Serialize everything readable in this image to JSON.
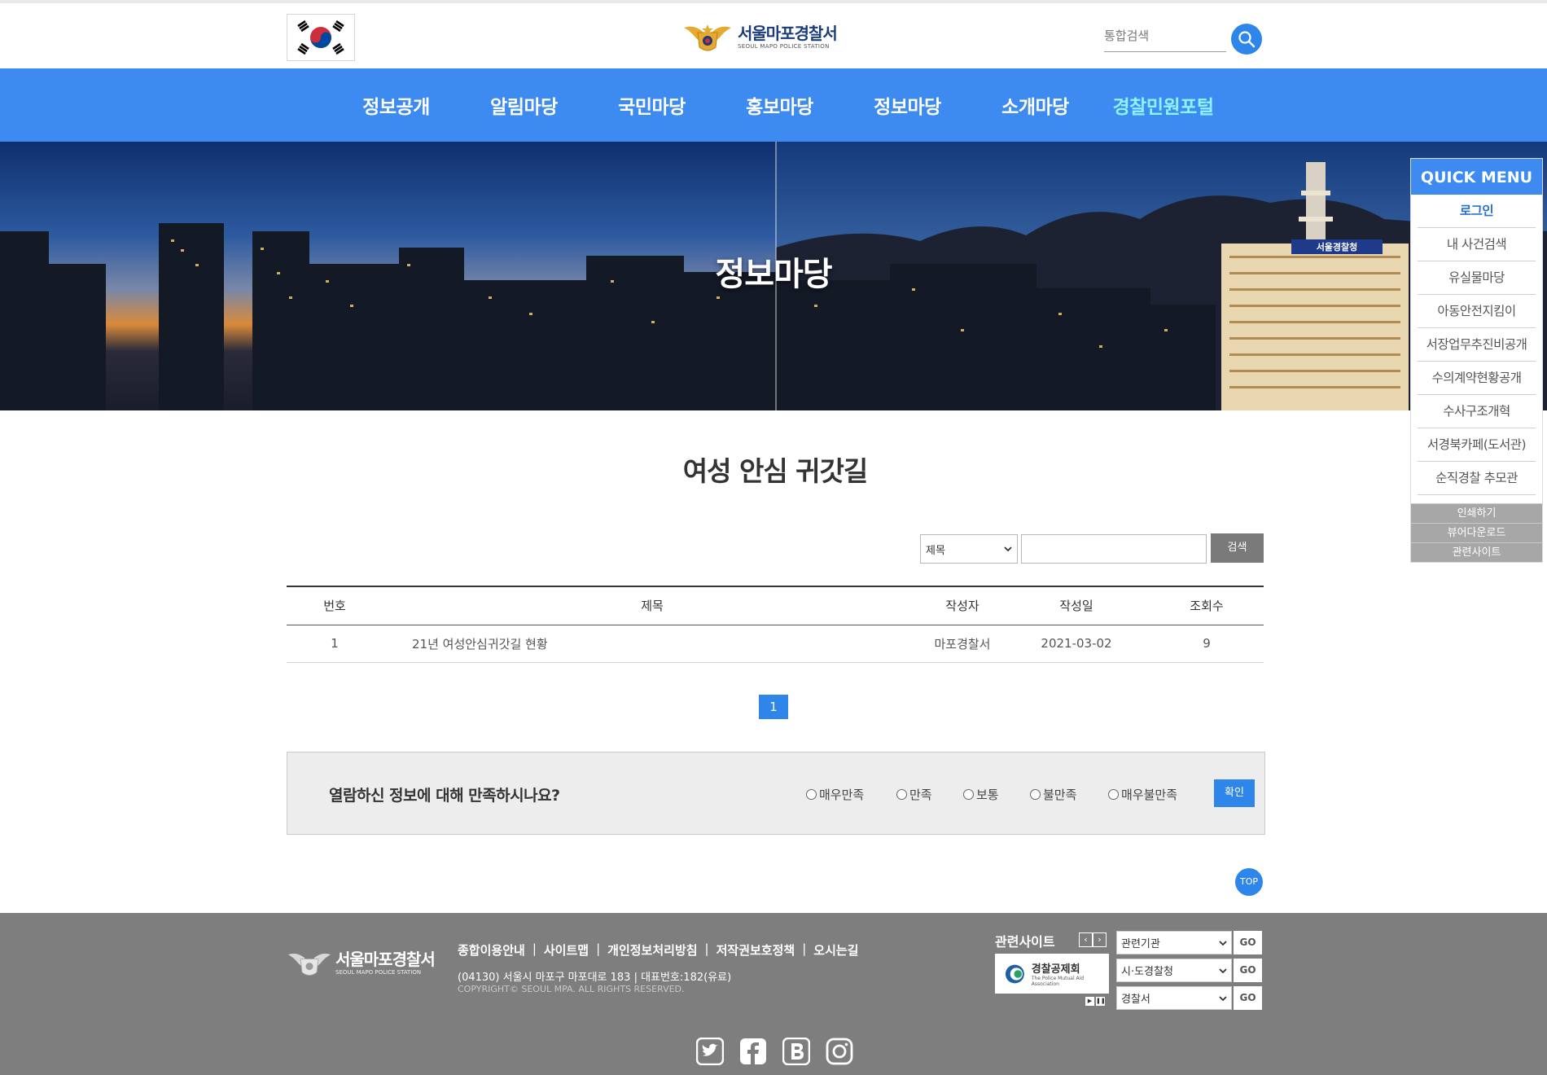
{
  "header": {
    "logo_kr": "서울마포경찰서",
    "logo_en": "SEOUL MAPO POLICE STATION",
    "search_placeholder": "통합검색"
  },
  "nav": {
    "items": [
      "정보공개",
      "알림마당",
      "국민마당",
      "홍보마당",
      "정보마당",
      "소개마당",
      "경찰민원포털"
    ]
  },
  "banner": {
    "title": "정보마당",
    "building_sign": "서울경찰청"
  },
  "quick_menu": {
    "title": "QUICK MENU",
    "items": [
      "로그인",
      "내 사건검색",
      "유실물마당",
      "아동안전지킴이",
      "서장업무추진비공개",
      "수의계약현황공개",
      "수사구조개혁",
      "서경북카페(도서관)",
      "순직경찰 추모관"
    ],
    "sub_items": [
      "인쇄하기",
      "뷰어다운로드",
      "관련사이트"
    ]
  },
  "content": {
    "page_title": "여성 안심 귀갓길",
    "search_select": "제목",
    "search_button": "검색"
  },
  "table": {
    "headers": [
      "번호",
      "제목",
      "작성자",
      "작성일",
      "조회수"
    ],
    "rows": [
      {
        "no": "1",
        "title": "21년 여성안심귀갓길 현황",
        "author": "마포경찰서",
        "date": "2021-03-02",
        "views": "9"
      }
    ]
  },
  "pagination": {
    "current": "1"
  },
  "survey": {
    "question": "열람하신 정보에 대해 만족하시나요?",
    "options": [
      "매우만족",
      "만족",
      "보통",
      "불만족",
      "매우불만족"
    ],
    "submit": "확인"
  },
  "top_button": "TOP",
  "footer": {
    "logo_kr": "서울마포경찰서",
    "logo_en": "SEOUL MAPO POLICE STATION",
    "links": [
      "종합이용안내",
      "사이트맵",
      "개인정보처리방침",
      "저작권보호정책",
      "오시는길"
    ],
    "address": "(04130) 서울시 마포구 마포대로 183   |   대표번호:182(유료)",
    "copyright": "COPYRIGHT© SEOUL MPA. ALL RIGHTS RESERVED.",
    "related_title": "관련사이트",
    "related_banner": "경찰공제회",
    "related_banner_en": "The Police Mutual Aid Association",
    "selects": [
      "관련기관",
      "시·도경찰청",
      "경찰서"
    ],
    "go_label": "GO",
    "social": [
      "twitter-icon",
      "facebook-icon",
      "blog-icon",
      "instagram-icon"
    ]
  },
  "colors": {
    "primary": "#3d8af0",
    "button_blue": "#2f86ea",
    "footer_bg": "#7e7e7e",
    "nav_highlight": "#8ff3ff"
  }
}
